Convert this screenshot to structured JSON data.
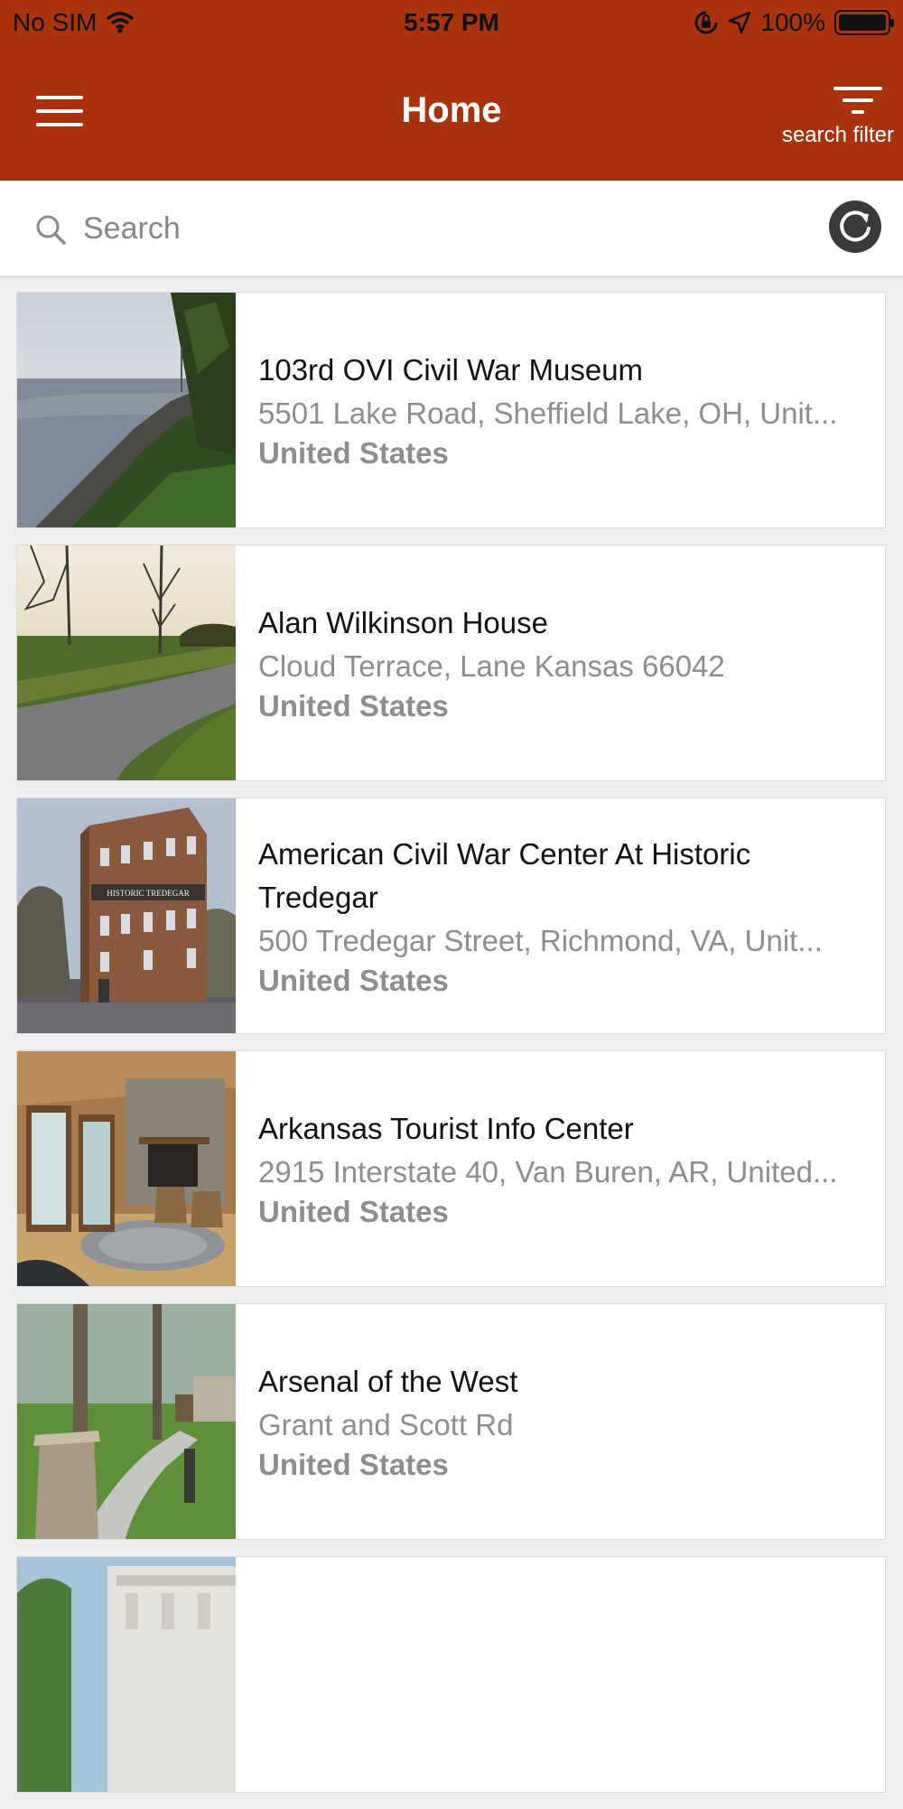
{
  "status_bar": {
    "carrier": "No SIM",
    "time": "5:57 PM",
    "battery": "100%"
  },
  "nav": {
    "title": "Home",
    "filter_label": "search filter"
  },
  "search": {
    "placeholder": "Search",
    "value": ""
  },
  "places": [
    {
      "title": "103rd OVI Civil War Museum",
      "address": "5501 Lake Road, Sheffield Lake, OH, Unit...",
      "country": "United States",
      "image": "lakeshore-photo"
    },
    {
      "title": "Alan Wilkinson House",
      "address": "Cloud Terrace, Lane Kansas 66042",
      "country": "United States",
      "image": "rural-road-photo"
    },
    {
      "title": "American Civil War Center At Historic Tredegar",
      "address": "500 Tredegar Street, Richmond, VA, Unit...",
      "country": "United States",
      "image": "brick-building-photo",
      "sign_text": "HISTORIC TREDEGAR"
    },
    {
      "title": "Arkansas Tourist Info Center",
      "address": "2915 Interstate 40, Van Buren, AR, United...",
      "country": "United States",
      "image": "interior-fireplace-photo"
    },
    {
      "title": "Arsenal of the West",
      "address": "Grant and Scott Rd",
      "country": "United States",
      "image": "park-marker-photo"
    },
    {
      "title": "",
      "address": "",
      "country": "",
      "image": "building-photo"
    }
  ],
  "colors": {
    "accent": "#a8330d",
    "secondary_text": "#8e8e8e"
  }
}
